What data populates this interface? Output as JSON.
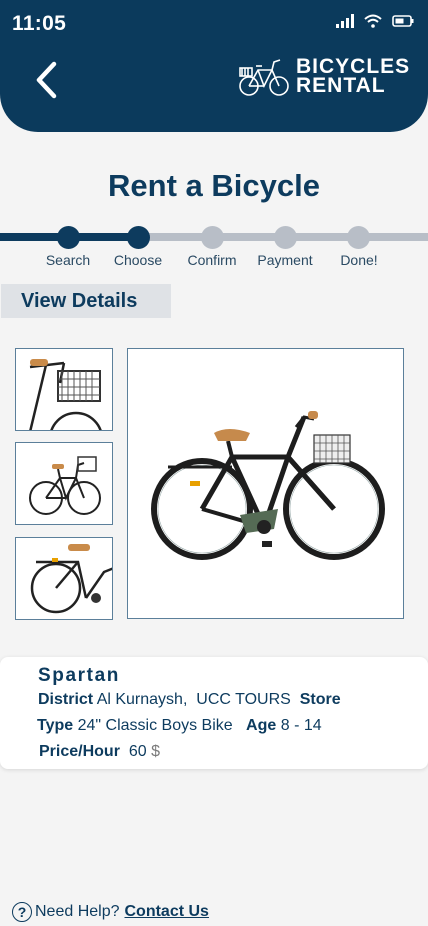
{
  "status": {
    "time": "11:05"
  },
  "header": {
    "back_icon": "chevron-left-icon",
    "brand_line1": "BICYCLES",
    "brand_line2": "RENTAL"
  },
  "title": "Rent a Bicycle",
  "stepper": {
    "steps": [
      "Search",
      "Choose",
      "Confirm",
      "Payment",
      "Done!"
    ],
    "current_step": 2
  },
  "section_tab": "View Details",
  "bike": {
    "name": "Spartan",
    "district_label": "District",
    "district_value": "Al Kurnaysh,",
    "store_value": "UCC TOURS",
    "store_label": "Store",
    "type_label": "Type",
    "type_value": "24\" Classic Boys Bike",
    "age_label": "Age",
    "age_value": "8 - 14",
    "price_label": "Price/Hour",
    "price_value": "60",
    "currency": "$"
  },
  "help": {
    "icon": "question-circle-icon",
    "text": "Need Help?",
    "link": "Contact Us"
  },
  "colors": {
    "primary": "#0b3a5c",
    "inactive_step": "#b8bec7",
    "background": "#f4f4f4"
  }
}
